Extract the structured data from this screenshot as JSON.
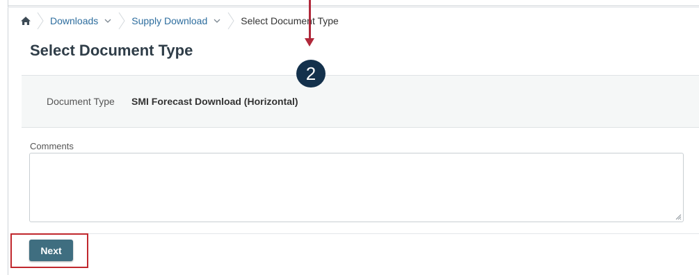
{
  "breadcrumb": {
    "home_icon": "home-icon",
    "items": [
      {
        "label": "Downloads",
        "has_dropdown": true
      },
      {
        "label": "Supply Download",
        "has_dropdown": true
      }
    ],
    "current": "Select Document Type"
  },
  "page": {
    "title": "Select Document Type"
  },
  "document_type": {
    "label": "Document Type",
    "value": "SMI Forecast Download (Horizontal)"
  },
  "comments": {
    "label": "Comments",
    "value": ""
  },
  "actions": {
    "next_label": "Next"
  },
  "annotations": {
    "step_number": "2",
    "highlight_color": "#c0272d",
    "arrow_color": "#b0283a",
    "badge_color": "#14314c"
  },
  "colors": {
    "link": "#2d6d9e",
    "button": "#3f6e80",
    "title": "#2f3d48"
  }
}
